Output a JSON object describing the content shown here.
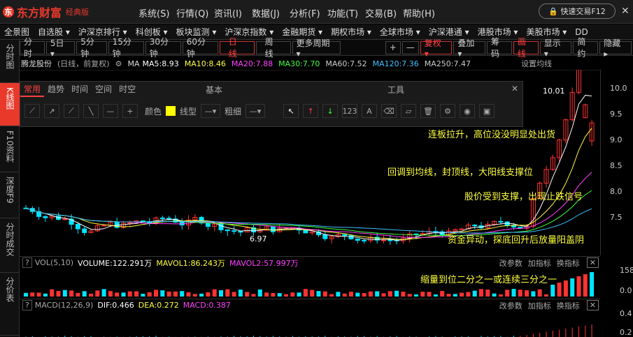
{
  "app": {
    "logo": "东方财富",
    "edition": "经典版",
    "quick_trade": "快速交易F12"
  },
  "menu": [
    "系统(S)",
    "行情(Q)",
    "资讯(I)",
    "数据(J)",
    "分析(F)",
    "功能(T)",
    "交易(B)",
    "帮助(H)"
  ],
  "nav": [
    "全景图",
    "自选股 ▾",
    "沪深京排行 ▾",
    "科创板 ▾",
    "板块监测 ▾",
    "沪深京指数 ▾",
    "金融期货 ▾",
    "期权市场 ▾",
    "全球市场 ▾",
    "沪深港通 ▾",
    "港股市场 ▾",
    "美股市场 ▾",
    "DD"
  ],
  "periods": [
    "分时",
    "5日 ▾",
    "5分钟",
    "15分钟",
    "30分钟",
    "60分钟",
    "日线",
    "周线",
    "更多周期 ▾"
  ],
  "right_tools": [
    "+",
    "—",
    "复权 ▾",
    "叠加 ▾",
    "筹码",
    "画线",
    "显示 ▾",
    "简约",
    "隐藏 ▸"
  ],
  "sidebar": [
    "分时图",
    "K线图",
    "F10资料",
    "深度F9",
    "分时成交",
    "分价表"
  ],
  "info": {
    "name": "腾龙股份",
    "mode": "(日线，前复权)",
    "ma_label": "MA",
    "ma5": "MA5:8.93",
    "ma10": "MA10:8.46",
    "ma20": "MA20:7.88",
    "ma30": "MA30:7.70",
    "ma60": "MA60:7.52",
    "ma120": "MA120:7.36",
    "ma250": "MA250:7.47",
    "settings": "设置均线"
  },
  "toolbox": {
    "tabs": [
      "常用",
      "趋势",
      "时间",
      "空间",
      "时空"
    ],
    "basic": "基本",
    "tools": "工具",
    "color": "颜色",
    "line_type": "线型",
    "thickness": "粗细"
  },
  "price": {
    "high_label": "10.01",
    "low_label": "6.97",
    "y_ticks": [
      "10.0",
      "9.5",
      "9.0",
      "8.5",
      "8.0",
      "7.5"
    ]
  },
  "annotations": [
    "连板拉升，高位没没明显处出货",
    "回调到均线，封顶线，大阳线支撑位",
    "股价受到支撑，出现止跌信号",
    "资金异动，探底回升后放量阳盖阴",
    "缩量到位二分之一或连续三分之一"
  ],
  "vol": {
    "label": "VOL(5,10)",
    "volume": "VOLUME:122.291万",
    "mavol1": "MAVOL1:86.243万",
    "mavol2": "MAVOL2:57.997万",
    "y1": "158.",
    "y0": "0.0"
  },
  "macd": {
    "label": "MACD(12,26,9)",
    "dif": "DIF:0.466",
    "dea": "DEA:0.272",
    "macd": "MACD:0.387",
    "y1": "0.4",
    "y0": "0.2"
  },
  "panel_tools": [
    "改参数",
    "加指标",
    "换指标"
  ],
  "colors": {
    "up": "#ff3232",
    "down": "#00e5ff",
    "bg": "#000000"
  }
}
